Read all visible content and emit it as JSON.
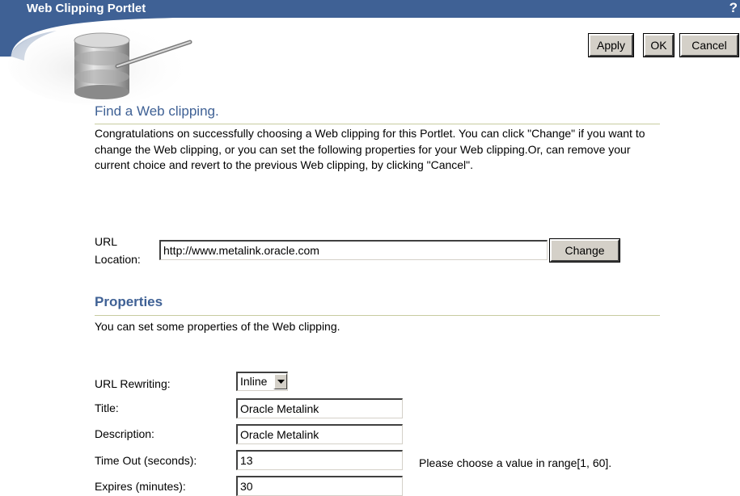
{
  "window": {
    "title": "Web Clipping Portlet",
    "help_glyph": "?",
    "header_color": "#3f6195"
  },
  "icons": {
    "logo": "database-cylinders-logo",
    "help": "help-icon",
    "dropdown": "chevron-down-icon"
  },
  "actions": {
    "apply_label": "Apply",
    "ok_label": "OK",
    "cancel_label": "Cancel"
  },
  "find_section": {
    "heading": "Find a Web clipping.",
    "description": "Congratulations on successfully choosing a Web clipping for this Portlet. You can click \"Change\" if you want to change the Web clipping, or you can set the following properties for your Web clipping.Or, can remove your current choice and revert to the previous Web clipping, by clicking \"Cancel\".",
    "url_label_line1": "URL",
    "url_label_line2": "Location:",
    "url_value": "http://www.metalink.oracle.com",
    "change_label": "Change"
  },
  "properties_section": {
    "heading": "Properties",
    "description": "You can set some properties of the Web clipping.",
    "url_rewriting_label": "URL Rewriting:",
    "url_rewriting_value": "Inline",
    "title_label": "Title:",
    "title_value": "Oracle Metalink",
    "description_label": "Description:",
    "description_value": "Oracle Metalink",
    "timeout_label": "Time Out (seconds):",
    "timeout_value": "13",
    "timeout_hint": "Please choose a value in range[1, 60].",
    "expires_label": "Expires (minutes):",
    "expires_value": "30"
  }
}
